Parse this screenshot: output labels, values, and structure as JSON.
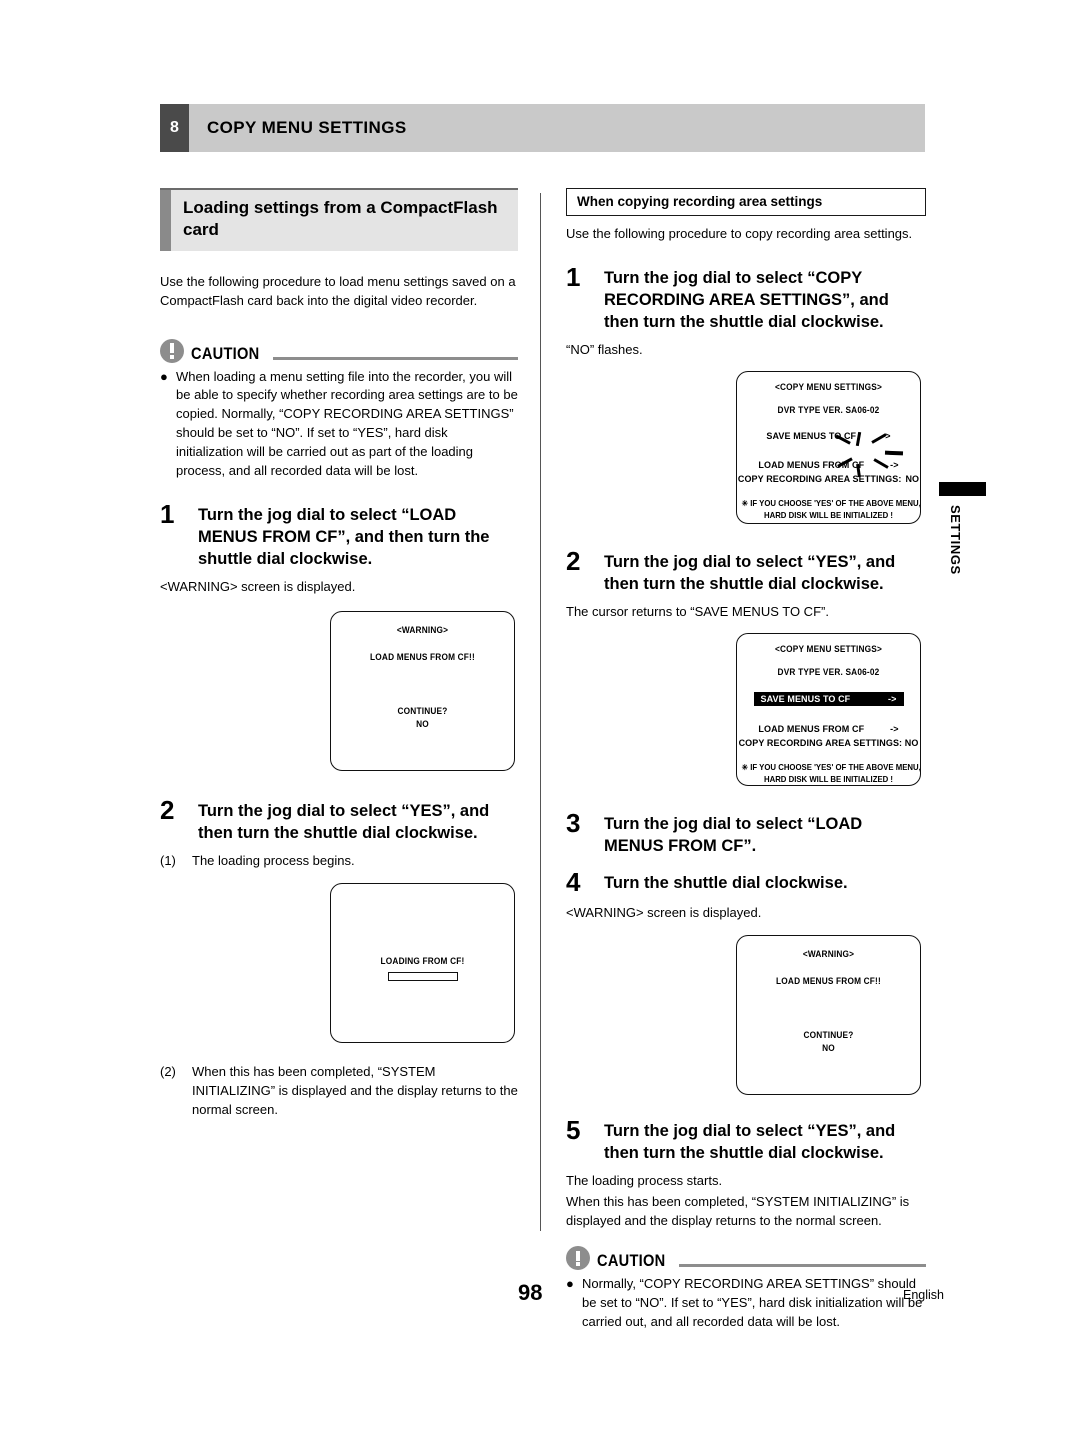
{
  "chapter": {
    "number": "8",
    "title": "COPY MENU SETTINGS"
  },
  "left_column": {
    "section_heading": "Loading settings from a CompactFlash card",
    "intro": "Use the following procedure to load menu settings saved on a CompactFlash card back into the digital video recorder.",
    "caution": {
      "label": "CAUTION",
      "bullet": "●",
      "text": "When loading a menu setting file into the recorder, you will be able to specify whether recording area settings are to be copied. Normally, “COPY RECORDING AREA SETTINGS” should be set to “NO”. If set to “YES”, hard disk initialization will be carried out as part of the loading process, and all recorded data will be lost."
    },
    "steps": [
      {
        "number": "1",
        "text": "Turn the jog dial to select “LOAD MENUS FROM CF”, and then turn the shuttle dial clockwise.",
        "caption": "<WARNING> screen is displayed."
      },
      {
        "number": "2",
        "text": "Turn the jog dial to select “YES”, and then turn the shuttle dial clockwise.",
        "sub1_num": "(1)",
        "sub1_text": "The loading process begins.",
        "sub2_num": "(2)",
        "sub2_text": "When this has been completed, “SYSTEM INITIALIZING” is displayed and the display returns to the normal screen."
      }
    ],
    "osd_warning": {
      "title": "<WARNING>",
      "message": "LOAD MENUS FROM CF!!",
      "prompt": "CONTINUE?",
      "value": "NO"
    },
    "osd_loading": {
      "label": "LOADING FROM CF!"
    }
  },
  "right_column": {
    "boxed_heading": "When copying recording area settings",
    "intro": "Use the following procedure to copy recording area settings.",
    "steps": [
      {
        "number": "1",
        "text": "Turn the jog dial to select “COPY RECORDING AREA SETTINGS”, and then turn the shuttle dial clockwise.",
        "caption": "“NO” flashes."
      },
      {
        "number": "2",
        "text": "Turn the jog dial to select “YES”, and then turn the shuttle dial clockwise.",
        "caption": "The cursor returns to “SAVE MENUS TO CF”."
      },
      {
        "number": "3",
        "text": "Turn the jog dial to select “LOAD MENUS FROM CF”."
      },
      {
        "number": "4",
        "text": "Turn the shuttle dial clockwise.",
        "caption": "<WARNING> screen is displayed."
      },
      {
        "number": "5",
        "text": "Turn the jog dial to select “YES”, and then turn the shuttle dial clockwise.",
        "caption_line1": "The loading process starts.",
        "caption_line2": "When this has been completed, “SYSTEM INITIALIZING” is displayed and the display returns to the normal screen."
      }
    ],
    "osd_menu_1": {
      "title": "<COPY MENU SETTINGS>",
      "version": "DVR TYPE VER. SA06-02",
      "save_label": "SAVE MENUS TO CF",
      "save_arrow": "->",
      "load_label": "LOAD MENUS FROM CF",
      "load_arrow": "->",
      "copy_label": "COPY RECORDING AREA SETTINGS:",
      "copy_value": "NO",
      "note_line1": "✳ IF YOU CHOOSE 'YES' OF THE ABOVE MENU,",
      "note_line2": "HARD DISK WILL BE INITIALIZED !"
    },
    "osd_menu_2": {
      "title": "<COPY MENU SETTINGS>",
      "version": "DVR TYPE VER. SA06-02",
      "save_label": "SAVE MENUS TO CF",
      "save_arrow": "->",
      "load_label": "LOAD MENUS FROM CF",
      "load_arrow": "->",
      "copy_label": "COPY RECORDING AREA SETTINGS: NO",
      "note_line1": "✳ IF YOU CHOOSE 'YES' OF THE ABOVE MENU,",
      "note_line2": "HARD DISK WILL BE INITIALIZED !"
    },
    "osd_warning": {
      "title": "<WARNING>",
      "message": "LOAD MENUS FROM CF!!",
      "prompt": "CONTINUE?",
      "value": "NO"
    },
    "caution": {
      "label": "CAUTION",
      "bullet": "●",
      "text": "Normally, “COPY RECORDING AREA SETTINGS” should be set to “NO”. If set to “YES”, hard disk initialization will be carried out, and all recorded data will be lost."
    }
  },
  "side_tab": {
    "label": "SETTINGS"
  },
  "footer": {
    "page_number": "98",
    "language": "English"
  }
}
